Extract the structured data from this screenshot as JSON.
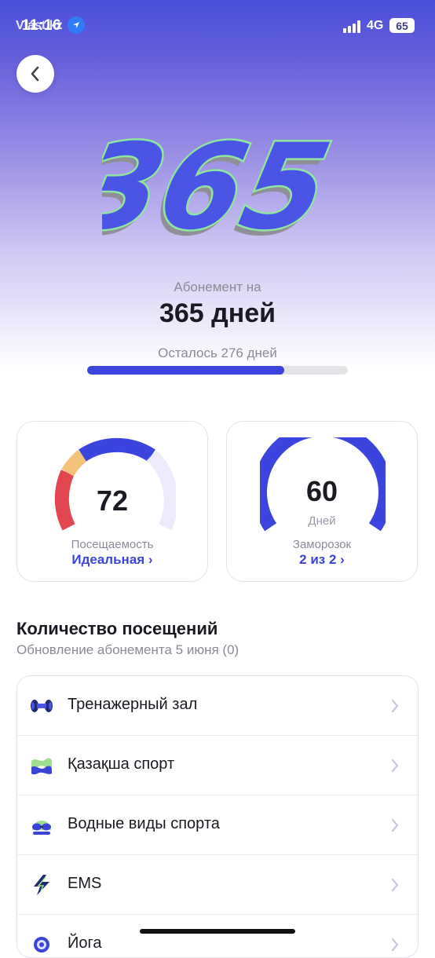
{
  "status_bar": {
    "time": "11:16",
    "watermark": "Vlast.kz",
    "network": "4G",
    "battery": "65"
  },
  "header": {
    "logo_text": "365",
    "subtitle": "Абонемент на",
    "title": "365 дней",
    "remaining": "Осталось 276 дней",
    "progress_fraction": 0.756
  },
  "cards": {
    "attendance": {
      "value": "72",
      "label": "Посещаемость",
      "link": "Идеальная ›"
    },
    "freeze": {
      "value": "60",
      "unit": "Дней",
      "label": "Заморозок",
      "link": "2 из 2 ›"
    }
  },
  "visits": {
    "title": "Количество посещений",
    "subtitle": "Обновление абонемента 5 июня (0)",
    "items": [
      {
        "label": "Тренажерный зал",
        "icon": "dumbbell-icon"
      },
      {
        "label": "Қазақша спорт",
        "icon": "kazakh-sport-icon"
      },
      {
        "label": "Водные виды спорта",
        "icon": "swim-goggles-icon"
      },
      {
        "label": "EMS",
        "icon": "lightning-icon"
      },
      {
        "label": "Йога",
        "icon": "lotus-icon"
      }
    ]
  },
  "colors": {
    "accent": "#3b45dd",
    "logo_fill": "#4a55e6",
    "logo_outline": "#8ee6a0",
    "gauge_orange": "#f5c27a",
    "gauge_red": "#e2474f",
    "gauge_track": "#eceafb"
  }
}
